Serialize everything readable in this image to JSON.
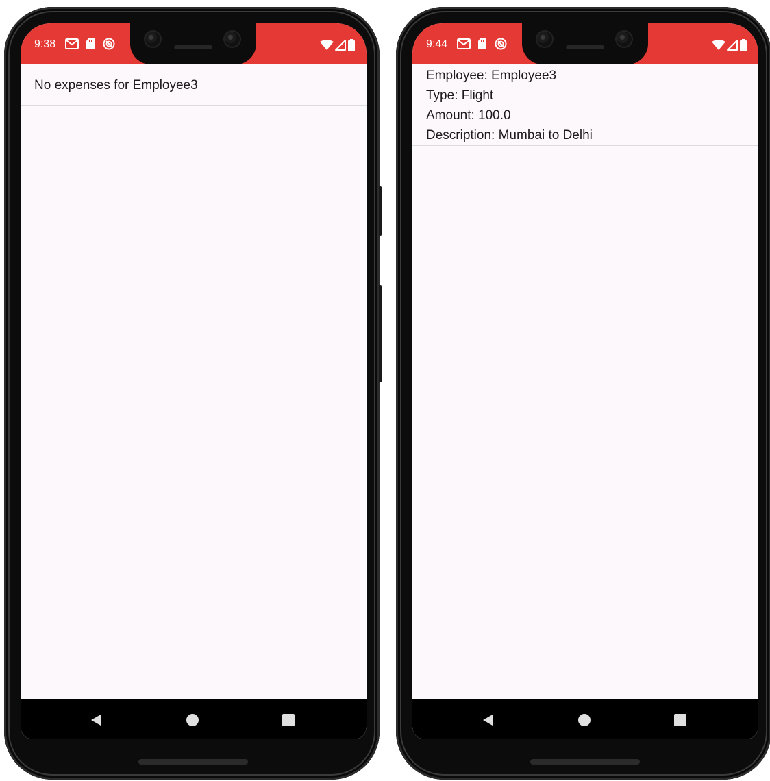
{
  "left_phone": {
    "status_bar": {
      "time": "9:38",
      "icons": [
        "gmail-icon",
        "sd-card-icon",
        "do-not-disturb-icon"
      ],
      "right_icons": [
        "wifi-icon",
        "signal-icon",
        "battery-icon"
      ],
      "color": "#e53935"
    },
    "list": {
      "message": "No expenses for Employee3"
    }
  },
  "right_phone": {
    "status_bar": {
      "time": "9:44",
      "icons": [
        "gmail-icon",
        "sd-card-icon",
        "do-not-disturb-icon"
      ],
      "right_icons": [
        "wifi-icon",
        "signal-icon",
        "battery-icon"
      ],
      "color": "#e53935"
    },
    "expense": {
      "employee": "Employee: Employee3",
      "type": "Type: Flight",
      "amount": "Amount: 100.0",
      "description": "Description: Mumbai to Delhi"
    }
  },
  "nav": {
    "icons": [
      "back-icon",
      "home-icon",
      "recents-icon"
    ]
  },
  "colors": {
    "status_bar": "#e53935",
    "background": "#fdf8fc",
    "nav_bar": "#000000"
  }
}
